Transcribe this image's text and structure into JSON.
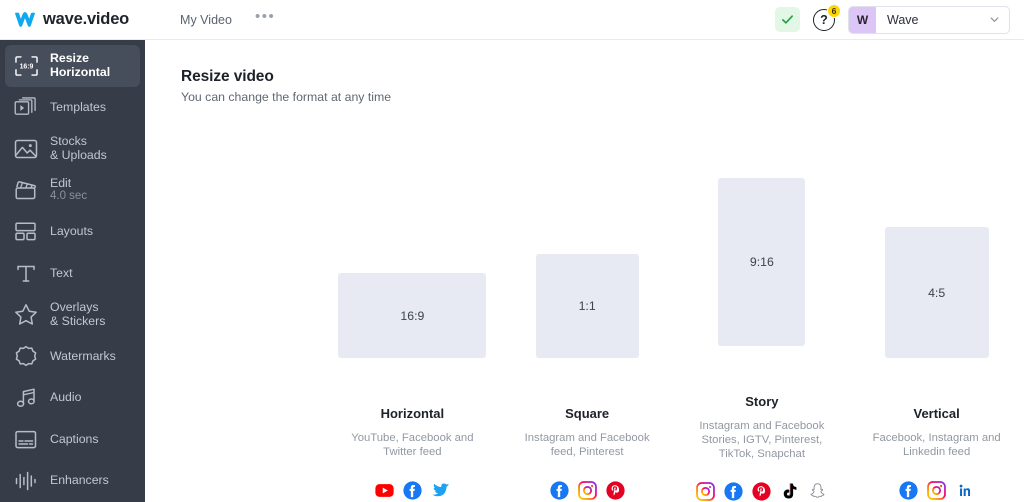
{
  "header": {
    "brand_name": "wave.video",
    "brand_icon": "wave-logo-icon",
    "nav_items": [
      {
        "label": "My Video",
        "name": "nav-my-video"
      }
    ],
    "more_label": "•••",
    "save_status_icon": "checkmark-icon",
    "help_icon": "question-mark-icon",
    "help_label": "?",
    "help_badge_count": "6",
    "workspace": {
      "avatar_initial": "W",
      "name": "Wave",
      "caret_icon": "chevron-down-icon"
    }
  },
  "sidebar": {
    "items": [
      {
        "name": "sidebar-item-resize",
        "icon": "resize-frame-icon",
        "label": "Resize",
        "sub": "Horizontal",
        "badge": "16:9",
        "active": true
      },
      {
        "name": "sidebar-item-templates",
        "icon": "templates-icon",
        "label": "Templates",
        "sub": "",
        "active": false
      },
      {
        "name": "sidebar-item-stocks-uploads",
        "icon": "image-icon",
        "label": "Stocks",
        "sub": "& Uploads",
        "active": false
      },
      {
        "name": "sidebar-item-edit",
        "icon": "clapperboard-icon",
        "label": "Edit",
        "sub": "4.0 sec",
        "subdim": true,
        "active": false
      },
      {
        "name": "sidebar-item-layouts",
        "icon": "layouts-icon",
        "label": "Layouts",
        "sub": "",
        "active": false
      },
      {
        "name": "sidebar-item-text",
        "icon": "text-t-icon",
        "label": "Text",
        "sub": "",
        "active": false
      },
      {
        "name": "sidebar-item-overlays-stickers",
        "icon": "star-icon",
        "label": "Overlays",
        "sub": "& Stickers",
        "active": false
      },
      {
        "name": "sidebar-item-watermarks",
        "icon": "watermark-badge-icon",
        "label": "Watermarks",
        "sub": "",
        "active": false
      },
      {
        "name": "sidebar-item-audio",
        "icon": "music-note-icon",
        "label": "Audio",
        "sub": "",
        "active": false
      },
      {
        "name": "sidebar-item-captions",
        "icon": "captions-icon",
        "label": "Captions",
        "sub": "",
        "active": false
      },
      {
        "name": "sidebar-item-enhancers",
        "icon": "waveform-icon",
        "label": "Enhancers",
        "sub": "",
        "active": false
      }
    ]
  },
  "main": {
    "title": "Resize video",
    "subtitle": "You can change the format at any time",
    "formats": [
      {
        "name": "format-card-horizontal",
        "ratio": "16:9",
        "ratio_class": "r169",
        "title": "Horizontal",
        "description": "YouTube, Facebook and Twitter feed",
        "socials": [
          "youtube",
          "facebook",
          "twitter"
        ]
      },
      {
        "name": "format-card-square",
        "ratio": "1:1",
        "ratio_class": "r11",
        "title": "Square",
        "description": "Instagram and Facebook feed, Pinterest",
        "socials": [
          "facebook",
          "instagram",
          "pinterest"
        ]
      },
      {
        "name": "format-card-story",
        "ratio": "9:16",
        "ratio_class": "r916",
        "title": "Story",
        "description": "Instagram and Facebook Stories, IGTV, Pinterest, TikTok, Snapchat",
        "socials": [
          "instagram",
          "facebook",
          "pinterest",
          "tiktok",
          "snapchat"
        ]
      },
      {
        "name": "format-card-vertical",
        "ratio": "4:5",
        "ratio_class": "r45",
        "title": "Vertical",
        "description": "Facebook, Instagram and Linkedin feed",
        "socials": [
          "facebook",
          "instagram",
          "linkedin"
        ]
      }
    ]
  },
  "colors": {
    "sidebar_bg": "#363d49",
    "sidebar_active": "#464e5b",
    "preview_box": "#e7eaf2",
    "brand_blue": "#0eaaf5",
    "badge_yellow": "#ffd60a",
    "avatar_purple": "#dcc6f7",
    "status_green": "#e3f7e6"
  }
}
